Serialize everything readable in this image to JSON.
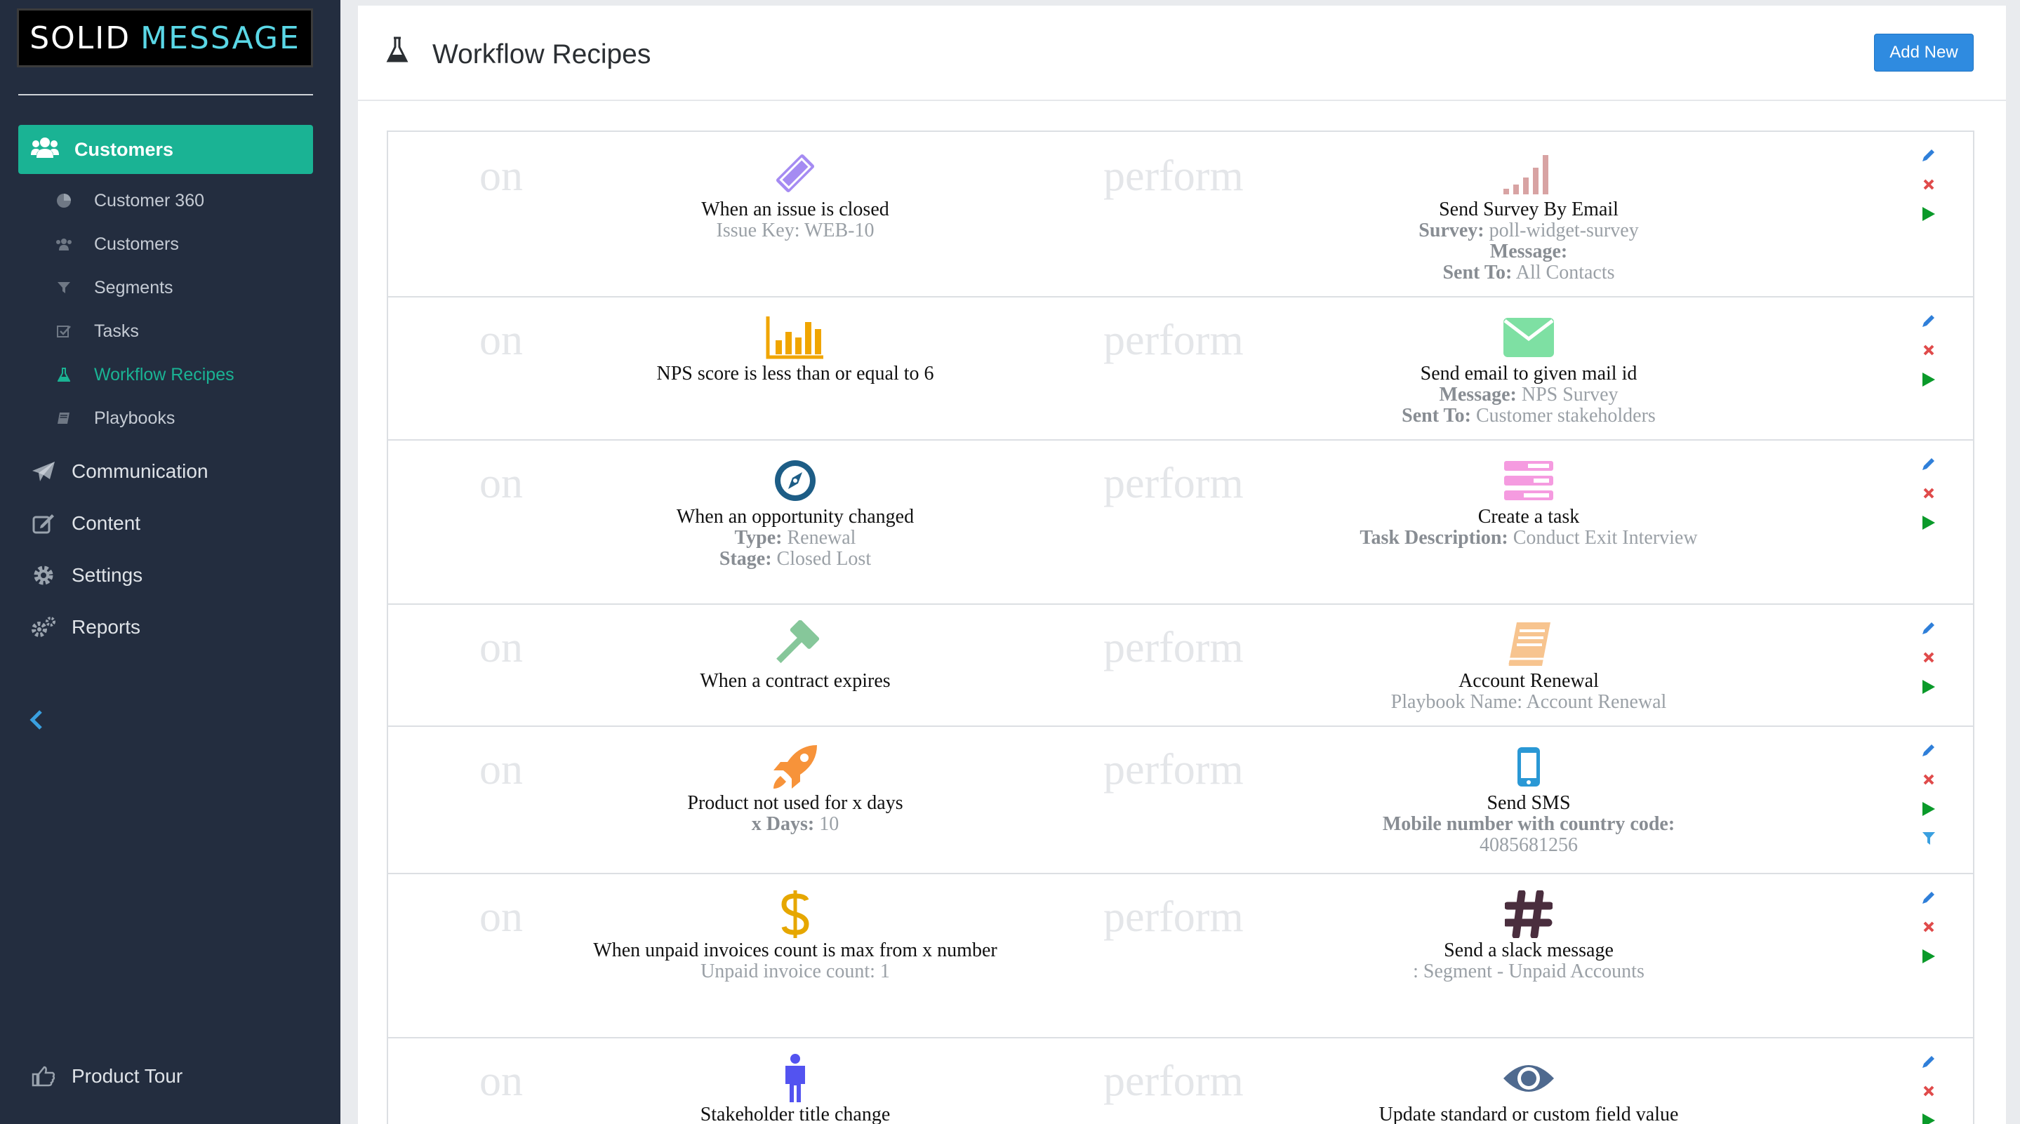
{
  "sidebar": {
    "logo": {
      "word1": "SOLID",
      "word2": "MESSAGE"
    },
    "active_section": "Customers",
    "sub_items": [
      {
        "label": "Customer 360",
        "icon": "pie-chart-icon"
      },
      {
        "label": "Customers",
        "icon": "users-icon"
      },
      {
        "label": "Segments",
        "icon": "filter-icon"
      },
      {
        "label": "Tasks",
        "icon": "checkbox-icon"
      },
      {
        "label": "Workflow Recipes",
        "icon": "flask-icon"
      },
      {
        "label": "Playbooks",
        "icon": "book-icon"
      }
    ],
    "main_items": [
      {
        "label": "Communication",
        "icon": "paper-plane-icon"
      },
      {
        "label": "Content",
        "icon": "edit-icon"
      },
      {
        "label": "Settings",
        "icon": "gear-icon"
      },
      {
        "label": "Reports",
        "icon": "gears-icon"
      }
    ],
    "product_tour": "Product Tour"
  },
  "header": {
    "title": "Workflow Recipes",
    "add_button": "Add New"
  },
  "labels": {
    "on": "on",
    "perform": "perform"
  },
  "recipes": [
    {
      "trigger": {
        "title": "When an issue is closed",
        "icon": "ticket-icon",
        "details": [
          {
            "text": "Issue Key: WEB-10"
          }
        ]
      },
      "action": {
        "title": "Send Survey By Email",
        "icon": "signal-icon",
        "details": [
          {
            "label": "Survey:",
            "text": "poll-widget-survey"
          },
          {
            "label": "Message:",
            "text": ""
          },
          {
            "label": "Sent To:",
            "text": "All Contacts"
          }
        ]
      }
    },
    {
      "trigger": {
        "title": "NPS score is less than or equal to 6",
        "icon": "bar-chart-icon",
        "details": []
      },
      "action": {
        "title": "Send email to given mail id",
        "icon": "envelope-icon",
        "details": [
          {
            "label": "Message:",
            "text": "NPS Survey"
          },
          {
            "label": "Sent To:",
            "text": "Customer stakeholders"
          }
        ]
      }
    },
    {
      "trigger": {
        "title": "When an opportunity changed",
        "icon": "compass-icon",
        "details": [
          {
            "label": "Type:",
            "text": "Renewal"
          },
          {
            "label": "Stage:",
            "text": "Closed Lost"
          }
        ]
      },
      "action": {
        "title": "Create a task",
        "icon": "tasks-icon",
        "details": [
          {
            "label": "Task Description:",
            "text": "Conduct Exit Interview"
          }
        ]
      }
    },
    {
      "trigger": {
        "title": "When a contract expires",
        "icon": "gavel-icon",
        "details": []
      },
      "action": {
        "title": "Account Renewal",
        "icon": "book-icon",
        "details": [
          {
            "text": "Playbook Name: Account Renewal"
          }
        ]
      }
    },
    {
      "trigger": {
        "title": "Product not used for x days",
        "icon": "rocket-icon",
        "details": [
          {
            "label": "x Days:",
            "text": "10"
          }
        ]
      },
      "action": {
        "title": "Send SMS",
        "icon": "mobile-icon",
        "details": [
          {
            "label": "Mobile number with country code:",
            "text": ""
          },
          {
            "text": "4085681256"
          }
        ]
      }
    },
    {
      "trigger": {
        "title": "When unpaid invoices count is max from x number",
        "icon": "dollar-icon",
        "details": [
          {
            "text": "Unpaid invoice count: 1"
          }
        ]
      },
      "action": {
        "title": "Send a slack message",
        "icon": "hashtag-icon",
        "details": [
          {
            "text": ": Segment - Unpaid Accounts"
          }
        ]
      }
    },
    {
      "trigger": {
        "title": "Stakeholder title change",
        "icon": "person-icon",
        "details": []
      },
      "action": {
        "title": "Update standard or custom field value",
        "icon": "eye-icon",
        "details": []
      }
    }
  ],
  "colors": {
    "sidebar_bg": "#232d3f",
    "accent": "#1ab394",
    "button_blue": "#2f8be0",
    "edit_blue": "#2f7fd9",
    "delete_red": "#e04b4b",
    "run_green": "#0a9a2a",
    "filter_blue": "#3aa0e0"
  }
}
